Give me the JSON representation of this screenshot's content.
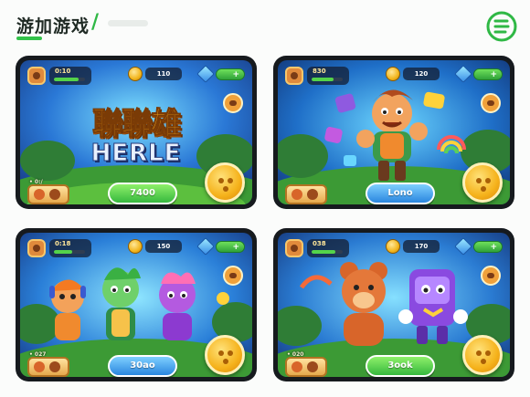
{
  "header": {
    "title": "游加游戏",
    "separator": "/"
  },
  "colors": {
    "accent": "#33c24a",
    "play_green": "#36b83e",
    "play_blue": "#2a86df",
    "gold": "#f5b21b"
  },
  "cards": [
    {
      "hud_stat": "0:10",
      "hud_stat_progress": 0.8,
      "coins": "110",
      "level_label": "• 0:/",
      "logo_cn": "聯聯雄",
      "logo_en": "HERLE",
      "play_label": "7400",
      "play_style": "green",
      "icons": [
        "avatar-icon",
        "coin-icon",
        "gem-icon",
        "plus-icon",
        "joystick-button"
      ]
    },
    {
      "hud_stat": "830",
      "hud_stat_progress": 0.7,
      "coins": "120",
      "level_label": "",
      "play_label": "Lono",
      "play_style": "blue",
      "icons": [
        "avatar-icon",
        "coin-icon",
        "gem-icon",
        "plus-icon",
        "joystick-button"
      ]
    },
    {
      "hud_stat": "0:18",
      "hud_stat_progress": 0.6,
      "coins": "150",
      "level_label": "• 027",
      "play_label": "30ao",
      "play_style": "blue",
      "icons": [
        "avatar-icon",
        "coin-icon",
        "gem-icon",
        "plus-icon",
        "joystick-button"
      ]
    },
    {
      "hud_stat": "038",
      "hud_stat_progress": 0.75,
      "coins": "170",
      "level_label": "• 020",
      "play_label": "3ook",
      "play_style": "green",
      "icons": [
        "avatar-icon",
        "coin-icon",
        "gem-icon",
        "plus-icon",
        "joystick-button"
      ]
    }
  ]
}
